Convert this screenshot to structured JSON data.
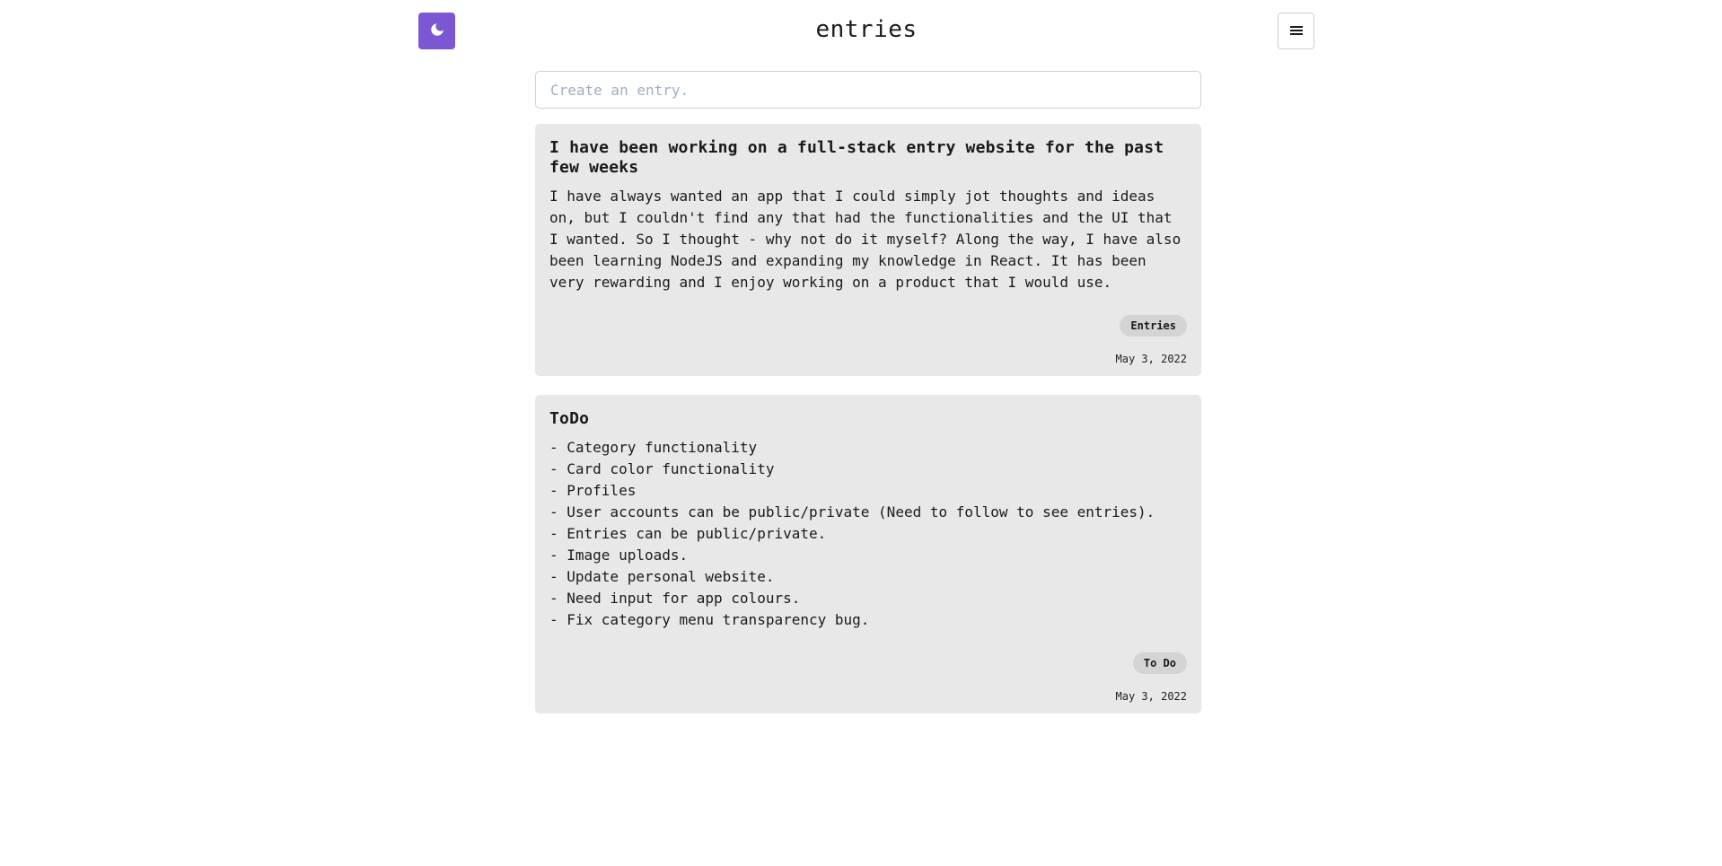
{
  "header": {
    "title": "entries",
    "theme_icon": "moon-icon",
    "menu_icon": "hamburger-icon"
  },
  "input": {
    "placeholder": "Create an entry."
  },
  "colors": {
    "accent": "#7b57d3",
    "card_bg": "#e8e8e8",
    "tag_bg": "#d4d4d4"
  },
  "entries": [
    {
      "title": "I have been working on a full-stack entry website for the past few weeks",
      "body": "I have always wanted an app that I could simply jot thoughts and ideas on, but I couldn't find any that had the functionalities and the UI that I wanted. So I thought - why not do it myself? Along the way, I have also been learning NodeJS and expanding my knowledge in React. It has been very rewarding and I enjoy working on a product that I would use.",
      "tag": "Entries",
      "date": "May 3, 2022"
    },
    {
      "title": "ToDo",
      "body": "- Category functionality\n- Card color functionality\n- Profiles\n- User accounts can be public/private (Need to follow to see entries).\n- Entries can be public/private.\n- Image uploads.\n- Update personal website.\n- Need input for app colours.\n- Fix category menu transparency bug.",
      "tag": "To Do",
      "date": "May 3, 2022"
    }
  ]
}
